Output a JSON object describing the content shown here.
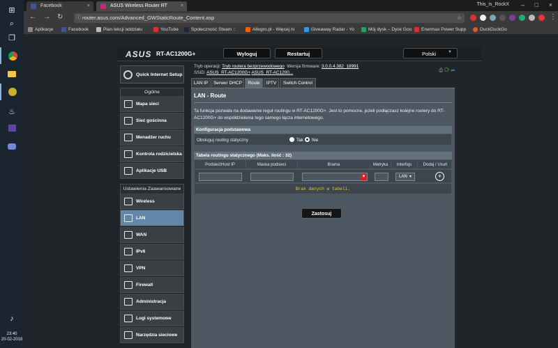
{
  "taskbar": {
    "clock_time": "23:40",
    "clock_date": "20-02-2018"
  },
  "browser": {
    "tabs": [
      {
        "label": "Facebook",
        "active": false,
        "color": "#3b5998"
      },
      {
        "label": "ASUS Wireless Router RT",
        "active": true,
        "color": "#c02a76"
      }
    ],
    "profile": "This_is_RockX",
    "url": "router.asus.com/Advanced_GWStaticRoute_Content.asp",
    "bookmarks": [
      {
        "label": "Aplikacje",
        "color": "#8a8a8a"
      },
      {
        "label": "Facebook",
        "color": "#3b5998"
      },
      {
        "label": "Plan lekcji oddziału",
        "color": "#bbbbbb"
      },
      {
        "label": "YouTube",
        "color": "#e52d27"
      },
      {
        "label": "Społeczność Steam ::",
        "color": "#1b2838"
      },
      {
        "label": "Allegro.pl - Więcej ni",
        "color": "#ff5a00"
      },
      {
        "label": "Giveaway Radar - Yo",
        "color": "#2d9cdb"
      },
      {
        "label": "Mój dysk – Dysk Goo",
        "color": "#1fa463"
      },
      {
        "label": "Enermax Power Supp",
        "color": "#d9302c"
      },
      {
        "label": "DuckDuckGo",
        "color": "#de5833"
      }
    ]
  },
  "router": {
    "brand": "ASUS",
    "model": "RT-AC1200G+",
    "logout": "Wyloguj",
    "restart": "Restartuj",
    "language": "Polski",
    "op_mode_label": "Tryb operacji:",
    "op_mode_value": "Tryb routera bezprzewodowego",
    "firmware_label": "Wersja firmware:",
    "firmware_value": "3.0.0.4.382_18991",
    "ssid_label": "SSID:",
    "ssid_1": "ASUS_RT-AC1200G+",
    "ssid_2": "ASUS_RT-AC1200...",
    "sidebar": {
      "qis": "Quick Internet Setup",
      "general_head": "Ogólne",
      "general_items": [
        "Mapa sieci",
        "Sieć gościnna",
        "Menadżer ruchu",
        "Kontrola rodzicielska",
        "Aplikacje USB"
      ],
      "advanced_head": "Ustawienia Zaawansowane",
      "advanced_items": [
        "Wireless",
        "LAN",
        "WAN",
        "IPv6",
        "VPN",
        "Firewall",
        "Administracja",
        "Logi systemowe",
        "Narzędzia sieciowe"
      ],
      "active_item": "LAN"
    },
    "subtabs": [
      "LAN IP",
      "Serwer DHCP",
      "Route",
      "IPTV",
      "Switch Control"
    ],
    "active_subtab": "Route",
    "page_title": "LAN - Route",
    "description": "Ta funkcja pozwala na dodawanie reguł routingu w RT-AC1200G+. Jest to pomocne, jeżeli podłączasz kolejne routery do RT-AC1200G+ do współdzielenia tego samego łącza internetowego.",
    "basic_config": {
      "head": "Konfiguracja podstawowa",
      "row_label": "Obsługuj routing statyczny",
      "option_yes": "Tak",
      "option_no": "Nie",
      "selected": "Nie"
    },
    "static_table": {
      "head": "Tabela routingu statycznego (Maks. ilość : 32)",
      "columns": [
        "Podsieć/Host IP",
        "Maska podsieci",
        "Brama",
        "Metryka",
        "Interfejs",
        "Dodaj / Usuń"
      ],
      "interface_value": "LAN",
      "empty_text": "Brak danych w tabeli."
    },
    "apply": "Zastosuj"
  }
}
